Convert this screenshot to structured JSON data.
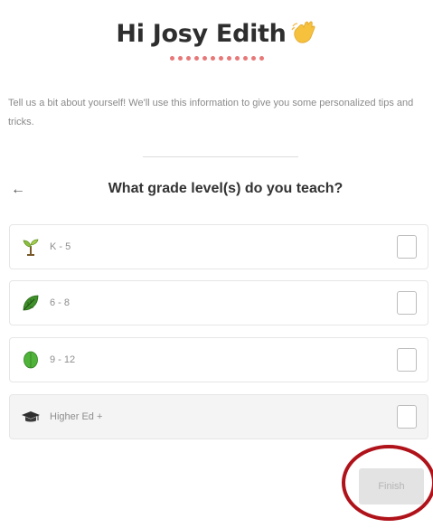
{
  "header": {
    "greeting": "Hi Josy Edith",
    "wave_icon": "waving-hand-icon"
  },
  "progress": {
    "total_steps": 12,
    "color": "#e87878"
  },
  "intro_text": "Tell us a bit about yourself! We'll use this information to give you some personalized tips and tricks.",
  "question": {
    "back_icon": "←",
    "text": "What grade level(s) do you teach?"
  },
  "options": [
    {
      "label": "K - 5",
      "icon": "sprout-icon",
      "checked": false
    },
    {
      "label": "6 - 8",
      "icon": "leaf-icon",
      "checked": false
    },
    {
      "label": "9 - 12",
      "icon": "green-leaf-icon",
      "checked": false
    },
    {
      "label": "Higher Ed +",
      "icon": "graduation-cap-icon",
      "checked": false
    }
  ],
  "finish_button": {
    "label": "Finish",
    "disabled": true
  },
  "annotation": {
    "ring_color": "#b0121a"
  }
}
